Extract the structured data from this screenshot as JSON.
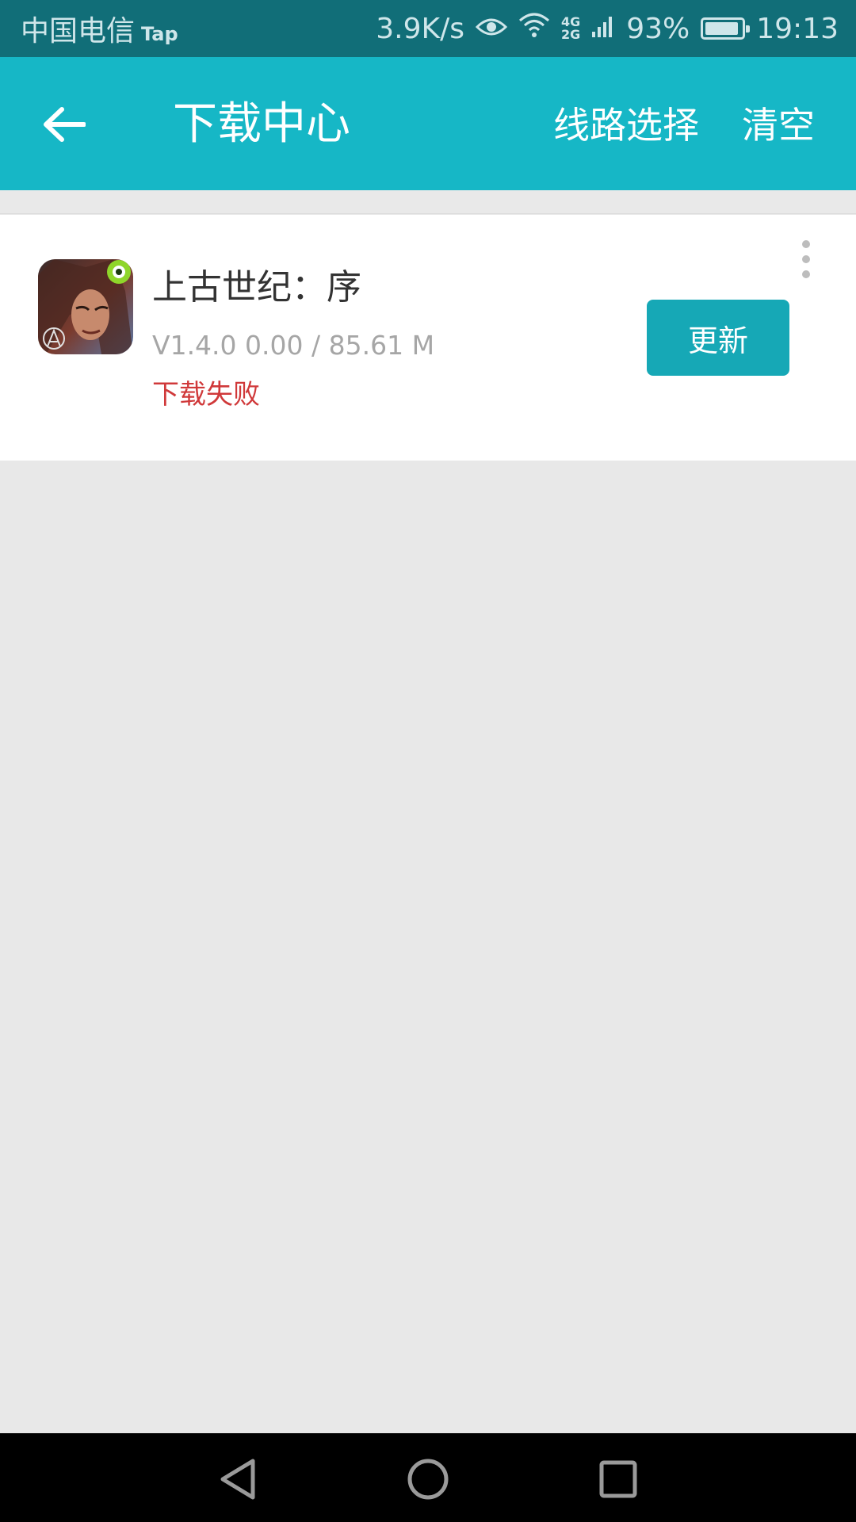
{
  "status_bar": {
    "carrier": "中国电信",
    "extra_app": "Tap",
    "net_speed": "3.9K/s",
    "network_4g": "4G",
    "network_2g": "2G",
    "battery_percent": "93%",
    "battery_level": 0.93,
    "time": "19:13"
  },
  "app_bar": {
    "title": "下载中心",
    "route_select_label": "线路选择",
    "clear_label": "清空",
    "color": "#16b7c6"
  },
  "download_item": {
    "name": "上古世纪：序",
    "meta": "V1.4.0 0.00 / 85.61 M",
    "status": "下载失败",
    "status_color": "#d0393a",
    "action_label": "更新",
    "icon": "game-icon"
  },
  "nav_bar": {
    "back": "back-triangle-icon",
    "home": "home-circle-icon",
    "recents": "recents-square-icon"
  }
}
